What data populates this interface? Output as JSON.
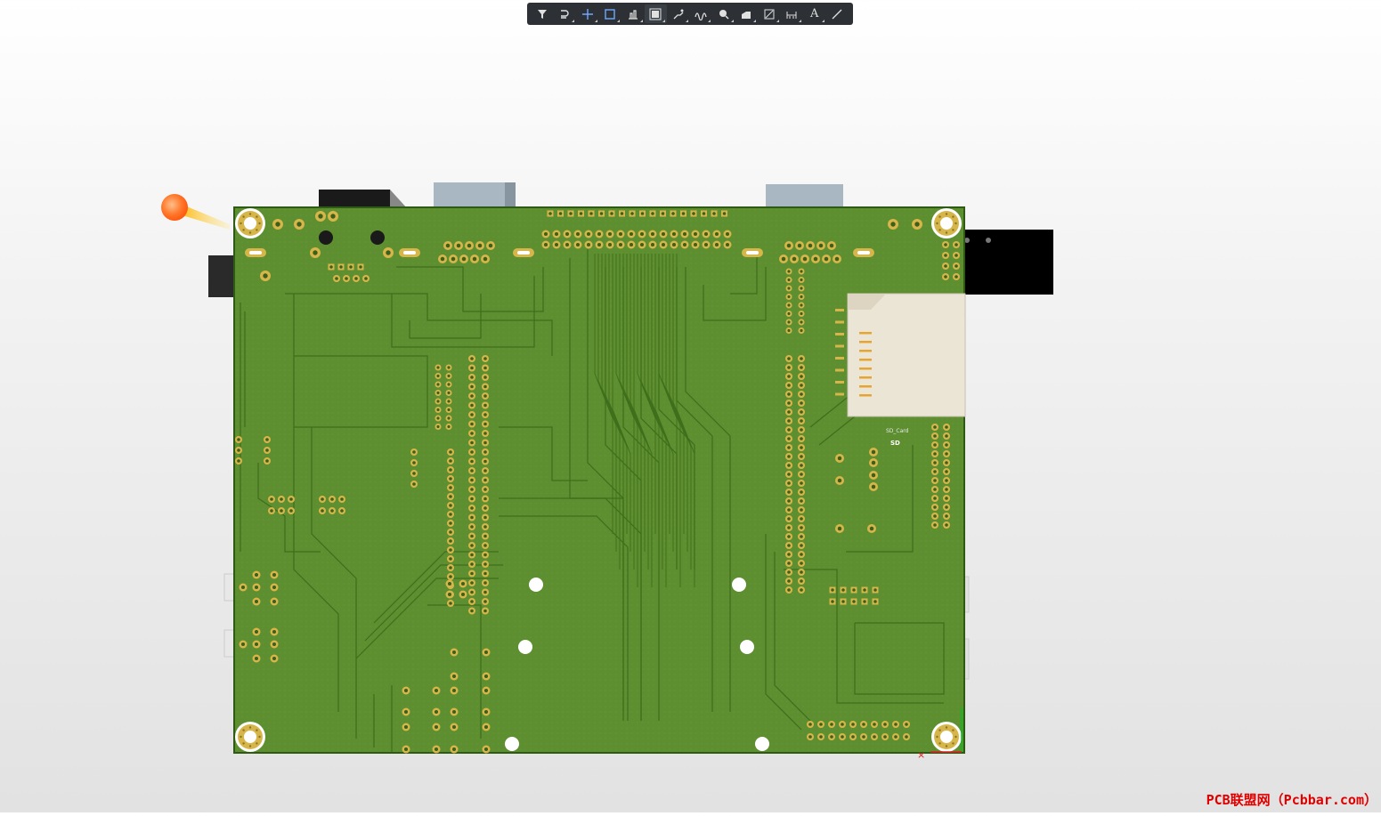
{
  "toolbar": {
    "buttons": [
      {
        "name": "filter-icon"
      },
      {
        "name": "route-icon"
      },
      {
        "name": "add-icon"
      },
      {
        "name": "rectangle-select-icon"
      },
      {
        "name": "align-icon"
      },
      {
        "name": "component-icon"
      },
      {
        "name": "interactive-route-icon"
      },
      {
        "name": "tune-length-icon"
      },
      {
        "name": "place-via-icon"
      },
      {
        "name": "polygon-fill-icon"
      },
      {
        "name": "region-icon"
      },
      {
        "name": "dimension-icon"
      },
      {
        "name": "text-icon",
        "glyph": "A"
      },
      {
        "name": "line-icon"
      }
    ]
  },
  "board": {
    "silkscreen_label": "SD_Card",
    "silkscreen_ref": "SD"
  },
  "watermark": "PCB联盟网（Pcbbar.com）",
  "colors": {
    "board": "#5a8a2e",
    "board_dark": "#3f6b1e",
    "trace": "#4a7a24",
    "pad": "#d6b64a",
    "background": "#f0f0f0",
    "toolbar": "#2d3136"
  }
}
